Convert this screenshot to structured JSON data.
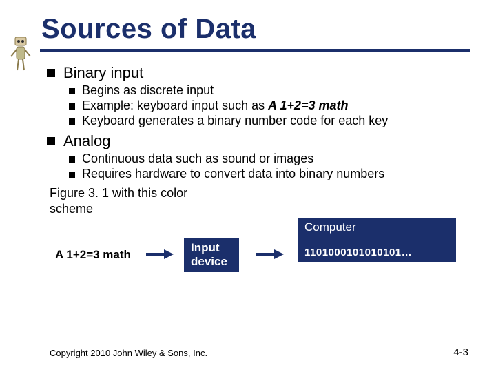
{
  "title": "Sources of Data",
  "bullets": {
    "b1": {
      "label": "Binary input",
      "sub": [
        "Begins as discrete input",
        {
          "prefix": "Example: keyboard input such as ",
          "ital": "A  1+2=3 math"
        },
        "Keyboard generates a binary number code for each key"
      ]
    },
    "b2": {
      "label": "Analog",
      "sub": [
        "Continuous data such as sound or images",
        "Requires hardware to convert data into binary numbers"
      ]
    }
  },
  "figure_caption": "Figure 3. 1 with this color scheme",
  "diagram": {
    "input_text": "A 1+2=3 math",
    "input_device": "Input device",
    "computer_label": "Computer",
    "bits": "1101000101010101…"
  },
  "footer": {
    "copyright": "Copyright 2010 John Wiley & Sons, Inc.",
    "page": "4-3"
  }
}
